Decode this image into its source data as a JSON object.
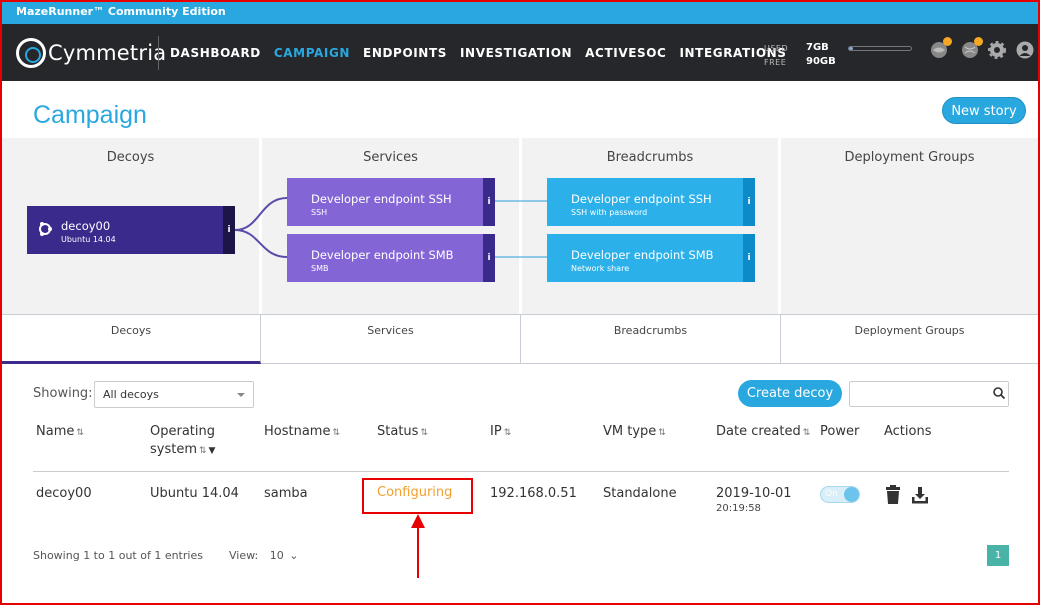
{
  "app": {
    "strip_title": "MazeRunner™ Community Edition",
    "logo_text": "Cymmetria"
  },
  "nav": {
    "items": [
      "DASHBOARD",
      "CAMPAIGN",
      "ENDPOINTS",
      "INVESTIGATION",
      "ACTIVESOC",
      "INTEGRATIONS"
    ],
    "active": "CAMPAIGN"
  },
  "storage": {
    "used_label": "USED",
    "free_label": "FREE",
    "used_value": "7GB",
    "free_value": "90GB",
    "used_fraction": 0.07
  },
  "page": {
    "title": "Campaign",
    "new_story_label": "New story"
  },
  "columns": [
    "Decoys",
    "Services",
    "Breadcrumbs",
    "Deployment Groups"
  ],
  "decoy_card": {
    "name": "decoy00",
    "os": "Ubuntu 14.04",
    "info": "i"
  },
  "service_cards": [
    {
      "title": "Developer endpoint SSH",
      "subtitle": "SSH",
      "info": "i"
    },
    {
      "title": "Developer endpoint SMB",
      "subtitle": "SMB",
      "info": "i"
    }
  ],
  "breadcrumb_cards": [
    {
      "title": "Developer endpoint SSH",
      "subtitle": "SSH with password",
      "info": "i"
    },
    {
      "title": "Developer endpoint SMB",
      "subtitle": "Network share",
      "info": "i"
    }
  ],
  "tabs": [
    "Decoys",
    "Services",
    "Breadcrumbs",
    "Deployment Groups"
  ],
  "toolbar": {
    "showing_label": "Showing:",
    "filter_value": "All decoys",
    "create_label": "Create decoy",
    "search_value": ""
  },
  "table": {
    "headers": {
      "name": "Name",
      "os_line1": "Operating",
      "os_line2": "system",
      "hostname": "Hostname",
      "status": "Status",
      "ip": "IP",
      "vm": "VM type",
      "date": "Date created",
      "power": "Power",
      "actions": "Actions"
    },
    "row": {
      "name": "decoy00",
      "os": "Ubuntu 14.04",
      "hostname": "samba",
      "status": "Configuring",
      "ip": "192.168.0.51",
      "vm": "Standalone",
      "date": "2019-10-01",
      "time": "20:19:58",
      "power": "On"
    }
  },
  "footer": {
    "entries": "Showing 1 to 1 out of 1 entries",
    "view_label": "View:",
    "view_value": "10",
    "page": "1"
  },
  "colors": {
    "accent": "#29a8e0",
    "decoy": "#3a2a8c",
    "service": "#8465d6",
    "breadcrumb": "#2bb0e9",
    "annotation": "#e60000"
  }
}
